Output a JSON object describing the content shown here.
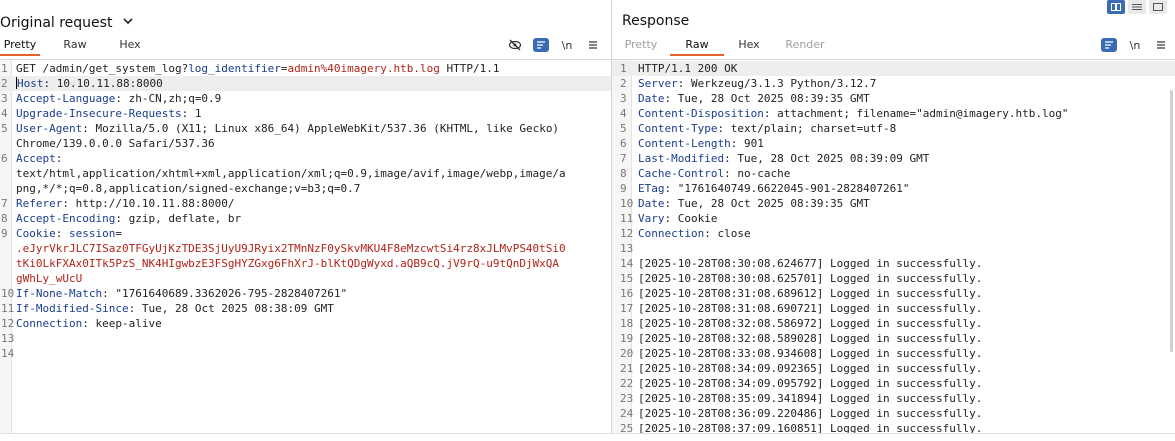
{
  "request": {
    "title": "Original request",
    "tabs": [
      {
        "label": "Pretty",
        "active": true
      },
      {
        "label": "Raw",
        "active": false
      },
      {
        "label": "Hex",
        "active": false
      }
    ],
    "tools": {
      "newline_label": "\\n"
    },
    "lines": [
      {
        "n": "1",
        "segs": [
          {
            "t": "plain",
            "v": "GET /admin/get_system_log?"
          },
          {
            "t": "param",
            "v": "log_identifier"
          },
          {
            "t": "plain",
            "v": "="
          },
          {
            "t": "val",
            "v": "admin%40imagery.htb.log"
          },
          {
            "t": "plain",
            "v": " HTTP/1.1"
          }
        ]
      },
      {
        "n": "2",
        "hl": true,
        "segs": [
          {
            "t": "key",
            "v": "Host"
          },
          {
            "t": "plain",
            "v": ": 10.10.11.88:8000"
          }
        ]
      },
      {
        "n": "3",
        "segs": [
          {
            "t": "key",
            "v": "Accept-Language"
          },
          {
            "t": "plain",
            "v": ": zh-CN,zh;q=0.9"
          }
        ]
      },
      {
        "n": "4",
        "segs": [
          {
            "t": "key",
            "v": "Upgrade-Insecure-Requests"
          },
          {
            "t": "plain",
            "v": ": 1"
          }
        ]
      },
      {
        "n": "5",
        "segs": [
          {
            "t": "key",
            "v": "User-Agent"
          },
          {
            "t": "plain",
            "v": ": Mozilla/5.0 (X11; Linux x86_64) AppleWebKit/537.36 (KHTML, like Gecko)"
          }
        ]
      },
      {
        "n": "",
        "segs": [
          {
            "t": "plain",
            "v": "Chrome/139.0.0.0 Safari/537.36"
          }
        ]
      },
      {
        "n": "6",
        "segs": [
          {
            "t": "key",
            "v": "Accept"
          },
          {
            "t": "plain",
            "v": ":"
          }
        ]
      },
      {
        "n": "",
        "segs": [
          {
            "t": "plain",
            "v": "text/html,application/xhtml+xml,application/xml;q=0.9,image/avif,image/webp,image/a"
          }
        ]
      },
      {
        "n": "",
        "segs": [
          {
            "t": "plain",
            "v": "png,*/*;q=0.8,application/signed-exchange;v=b3;q=0.7"
          }
        ]
      },
      {
        "n": "7",
        "segs": [
          {
            "t": "key",
            "v": "Referer"
          },
          {
            "t": "plain",
            "v": ": http://10.10.11.88:8000/"
          }
        ]
      },
      {
        "n": "8",
        "segs": [
          {
            "t": "key",
            "v": "Accept-Encoding"
          },
          {
            "t": "plain",
            "v": ": gzip, deflate, br"
          }
        ]
      },
      {
        "n": "9",
        "segs": [
          {
            "t": "key",
            "v": "Cookie"
          },
          {
            "t": "plain",
            "v": ": "
          },
          {
            "t": "param",
            "v": "session"
          },
          {
            "t": "plain",
            "v": "="
          }
        ]
      },
      {
        "n": "",
        "segs": [
          {
            "t": "val",
            "v": ".eJyrVkrJLC7ISaz0TFGyUjKzTDE3SjUyU9JRyix2TMnNzF0ySkvMKU4F8eMzcwtSi4rz8xJLMvPS40tSi0"
          }
        ]
      },
      {
        "n": "",
        "segs": [
          {
            "t": "val",
            "v": "tKi0LkFXAx0ITk5PzS_NK4HIgwbzE3FSgHYZGxg6FhXrJ-blKtQDgWyxd.aQB9cQ.jV9rQ-u9tQnDjWxQA"
          }
        ]
      },
      {
        "n": "",
        "segs": [
          {
            "t": "val",
            "v": "gWhLy_wUcU"
          }
        ]
      },
      {
        "n": "10",
        "segs": [
          {
            "t": "key",
            "v": "If-None-Match"
          },
          {
            "t": "plain",
            "v": ": \"1761640689.3362026-795-2828407261\""
          }
        ]
      },
      {
        "n": "11",
        "segs": [
          {
            "t": "key",
            "v": "If-Modified-Since"
          },
          {
            "t": "plain",
            "v": ": Tue, 28 Oct 2025 08:38:09 GMT"
          }
        ]
      },
      {
        "n": "12",
        "segs": [
          {
            "t": "key",
            "v": "Connection"
          },
          {
            "t": "plain",
            "v": ": keep-alive"
          }
        ]
      },
      {
        "n": "13",
        "segs": []
      },
      {
        "n": "14",
        "segs": []
      }
    ]
  },
  "response": {
    "title": "Response",
    "tabs": [
      {
        "label": "Pretty",
        "active": false,
        "disabled": true
      },
      {
        "label": "Raw",
        "active": true
      },
      {
        "label": "Hex",
        "active": false
      },
      {
        "label": "Render",
        "active": false,
        "disabled": true
      }
    ],
    "tools": {
      "newline_label": "\\n"
    },
    "lines": [
      {
        "n": "1",
        "hl": true,
        "segs": [
          {
            "t": "plain",
            "v": "HTTP/1.1 200 OK"
          }
        ]
      },
      {
        "n": "2",
        "segs": [
          {
            "t": "key",
            "v": "Server"
          },
          {
            "t": "plain",
            "v": ": Werkzeug/3.1.3 Python/3.12.7"
          }
        ]
      },
      {
        "n": "3",
        "segs": [
          {
            "t": "key",
            "v": "Date"
          },
          {
            "t": "plain",
            "v": ": Tue, 28 Oct 2025 08:39:35 GMT"
          }
        ]
      },
      {
        "n": "4",
        "segs": [
          {
            "t": "key",
            "v": "Content-Disposition"
          },
          {
            "t": "plain",
            "v": ": attachment; filename=\"admin@imagery.htb.log\""
          }
        ]
      },
      {
        "n": "5",
        "segs": [
          {
            "t": "key",
            "v": "Content-Type"
          },
          {
            "t": "plain",
            "v": ": text/plain; charset=utf-8"
          }
        ]
      },
      {
        "n": "6",
        "segs": [
          {
            "t": "key",
            "v": "Content-Length"
          },
          {
            "t": "plain",
            "v": ": 901"
          }
        ]
      },
      {
        "n": "7",
        "segs": [
          {
            "t": "key",
            "v": "Last-Modified"
          },
          {
            "t": "plain",
            "v": ": Tue, 28 Oct 2025 08:39:09 GMT"
          }
        ]
      },
      {
        "n": "8",
        "segs": [
          {
            "t": "key",
            "v": "Cache-Control"
          },
          {
            "t": "plain",
            "v": ": no-cache"
          }
        ]
      },
      {
        "n": "9",
        "segs": [
          {
            "t": "key",
            "v": "ETag"
          },
          {
            "t": "plain",
            "v": ": \"1761640749.6622045-901-2828407261\""
          }
        ]
      },
      {
        "n": "10",
        "segs": [
          {
            "t": "key",
            "v": "Date"
          },
          {
            "t": "plain",
            "v": ": Tue, 28 Oct 2025 08:39:35 GMT"
          }
        ]
      },
      {
        "n": "11",
        "segs": [
          {
            "t": "key",
            "v": "Vary"
          },
          {
            "t": "plain",
            "v": ": Cookie"
          }
        ]
      },
      {
        "n": "12",
        "segs": [
          {
            "t": "key",
            "v": "Connection"
          },
          {
            "t": "plain",
            "v": ": close"
          }
        ]
      },
      {
        "n": "13",
        "segs": []
      },
      {
        "n": "14",
        "segs": [
          {
            "t": "plain",
            "v": "[2025-10-28T08:30:08.624677] Logged in successfully."
          }
        ]
      },
      {
        "n": "15",
        "segs": [
          {
            "t": "plain",
            "v": "[2025-10-28T08:30:08.625701] Logged in successfully."
          }
        ]
      },
      {
        "n": "16",
        "segs": [
          {
            "t": "plain",
            "v": "[2025-10-28T08:31:08.689612] Logged in successfully."
          }
        ]
      },
      {
        "n": "17",
        "segs": [
          {
            "t": "plain",
            "v": "[2025-10-28T08:31:08.690721] Logged in successfully."
          }
        ]
      },
      {
        "n": "18",
        "segs": [
          {
            "t": "plain",
            "v": "[2025-10-28T08:32:08.586972] Logged in successfully."
          }
        ]
      },
      {
        "n": "19",
        "segs": [
          {
            "t": "plain",
            "v": "[2025-10-28T08:32:08.589028] Logged in successfully."
          }
        ]
      },
      {
        "n": "20",
        "segs": [
          {
            "t": "plain",
            "v": "[2025-10-28T08:33:08.934608] Logged in successfully."
          }
        ]
      },
      {
        "n": "21",
        "segs": [
          {
            "t": "plain",
            "v": "[2025-10-28T08:34:09.092365] Logged in successfully."
          }
        ]
      },
      {
        "n": "22",
        "segs": [
          {
            "t": "plain",
            "v": "[2025-10-28T08:34:09.095792] Logged in successfully."
          }
        ]
      },
      {
        "n": "23",
        "segs": [
          {
            "t": "plain",
            "v": "[2025-10-28T08:35:09.341894] Logged in successfully."
          }
        ]
      },
      {
        "n": "24",
        "segs": [
          {
            "t": "plain",
            "v": "[2025-10-28T08:36:09.220486] Logged in successfully."
          }
        ]
      },
      {
        "n": "25",
        "segs": [
          {
            "t": "plain",
            "v": "[2025-10-28T08:37:09.160851] Logged in successfully."
          }
        ]
      }
    ]
  },
  "layout_toggle": {
    "active_index": 0
  },
  "colors": {
    "accent": "#e8612c",
    "tool_blue": "#3a6bb5",
    "header_key": "#1a3d8f",
    "value_red": "#b42318"
  }
}
